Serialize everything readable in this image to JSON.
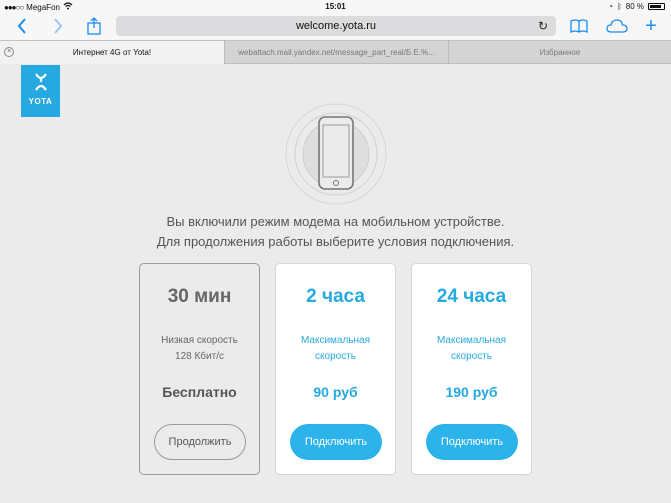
{
  "status_bar": {
    "carrier": "MegaFon",
    "time": "15:01",
    "battery": "80 %"
  },
  "toolbar": {
    "url": "welcome.yota.ru"
  },
  "tabs": [
    {
      "label": "Интернет 4G от Yota!"
    },
    {
      "label": "webattach.mail.yandex.net/message_part_real/Б.Е.%..."
    },
    {
      "label": "Избранное"
    }
  ],
  "logo": {
    "text": "YOTA"
  },
  "headline": {
    "line1": "Вы включили режим модема на мобильном устройстве.",
    "line2": "Для продолжения работы выберите условия подключения."
  },
  "plans": [
    {
      "title": "30 мин",
      "desc_line1": "Низкая скорость",
      "desc_line2": "128 Кбит/с",
      "price": "Бесплатно",
      "button": "Продолжить"
    },
    {
      "title": "2 часа",
      "desc_line1": "Максимальная",
      "desc_line2": "скорость",
      "price": "90 руб",
      "button": "Подключить"
    },
    {
      "title": "24 часа",
      "desc_line1": "Максимальная",
      "desc_line2": "скорость",
      "price": "190 руб",
      "button": "Подключить"
    }
  ],
  "colors": {
    "accent": "#26a9e0",
    "background": "#ebebeb"
  }
}
